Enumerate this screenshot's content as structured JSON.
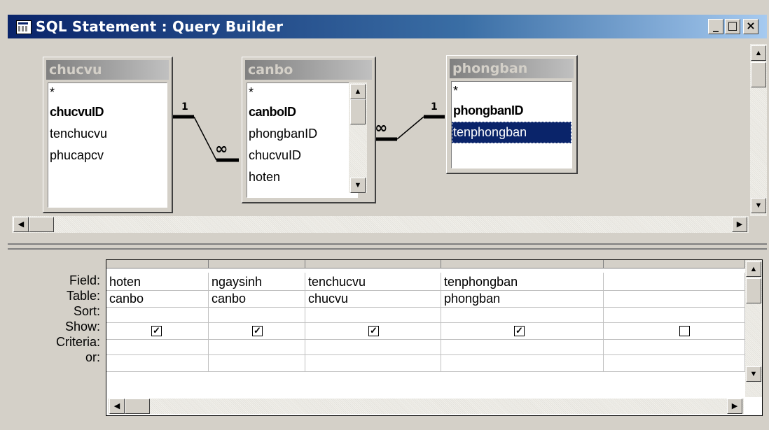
{
  "window": {
    "title": "SQL Statement : Query Builder",
    "buttons": {
      "minimize": "_",
      "maximize": "□",
      "close": "×"
    }
  },
  "tables": [
    {
      "name": "chucvu",
      "fields": [
        {
          "label": "*",
          "bold": false
        },
        {
          "label": "chucvuID",
          "bold": true
        },
        {
          "label": "tenchucvu",
          "bold": false
        },
        {
          "label": "phucapcv",
          "bold": false
        }
      ]
    },
    {
      "name": "canbo",
      "fields": [
        {
          "label": "*",
          "bold": false
        },
        {
          "label": "canboID",
          "bold": true
        },
        {
          "label": "phongbanID",
          "bold": false
        },
        {
          "label": "chucvuID",
          "bold": false
        },
        {
          "label": "hoten",
          "bold": false
        }
      ]
    },
    {
      "name": "phongban",
      "fields": [
        {
          "label": "*",
          "bold": false
        },
        {
          "label": "phongbanID",
          "bold": true
        },
        {
          "label": "tenphongban",
          "bold": false,
          "selected": true
        }
      ]
    }
  ],
  "relationships": [
    {
      "one": "1",
      "many": "∞"
    },
    {
      "one": "1",
      "many": "∞"
    }
  ],
  "grid": {
    "row_labels": [
      "Field:",
      "Table:",
      "Sort:",
      "Show:",
      "Criteria:",
      "or:"
    ],
    "columns": [
      {
        "field": "hoten",
        "table": "canbo",
        "sort": "",
        "show": true,
        "criteria": "",
        "or": ""
      },
      {
        "field": "ngaysinh",
        "table": "canbo",
        "sort": "",
        "show": true,
        "criteria": "",
        "or": ""
      },
      {
        "field": "tenchucvu",
        "table": "chucvu",
        "sort": "",
        "show": true,
        "criteria": "",
        "or": ""
      },
      {
        "field": "tenphongban",
        "table": "phongban",
        "sort": "",
        "show": true,
        "criteria": "",
        "or": ""
      },
      {
        "field": "",
        "table": "",
        "sort": "",
        "show": false,
        "criteria": "",
        "or": ""
      }
    ]
  },
  "icons": [
    "query-builder-icon",
    "scroll-up-icon",
    "scroll-down-icon",
    "scroll-left-icon",
    "scroll-right-icon",
    "checkbox-icon"
  ],
  "colors": {
    "titlebar_start": "#0a246a",
    "titlebar_end": "#a6caf0",
    "face": "#d4d0c8",
    "selection": "#0a246a"
  }
}
